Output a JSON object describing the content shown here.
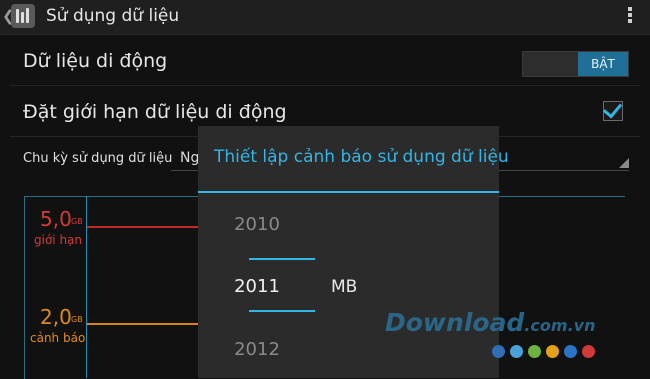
{
  "actionbar": {
    "title": "Sử dụng dữ liệu",
    "back_icon": "chevron-left-icon",
    "app_icon": "data-usage-settings-icon",
    "overflow_icon": "overflow-menu-icon"
  },
  "mobile_data": {
    "label": "Dữ liệu di động",
    "toggle_on_label": "BẬT",
    "state": "on"
  },
  "limit_setting": {
    "label": "Đặt giới hạn dữ liệu di động",
    "checked": true
  },
  "cycle": {
    "label": "Chu kỳ sử dụng dữ liệu",
    "value": "Ng"
  },
  "chart": {
    "limit": {
      "value": "5,0",
      "unit": "GB",
      "label": "giới hạn",
      "color": "#d23a3a"
    },
    "warning": {
      "value": "2,0",
      "unit": "GB",
      "label": "cảnh báo",
      "color": "#e08a1e"
    }
  },
  "dialog": {
    "title": "Thiết lập cảnh báo sử dụng dữ liệu",
    "picker": {
      "above": "2010",
      "selected": "2011",
      "below": "2012"
    },
    "unit": "MB"
  },
  "watermark": {
    "text": "Download",
    "domain": ".com.vn",
    "dot_colors": [
      "#2f6fb5",
      "#4aa0d8",
      "#6cb33f",
      "#e3a11a",
      "#2a74c8",
      "#d23a3a"
    ]
  },
  "colors": {
    "accent": "#33b5e5"
  }
}
